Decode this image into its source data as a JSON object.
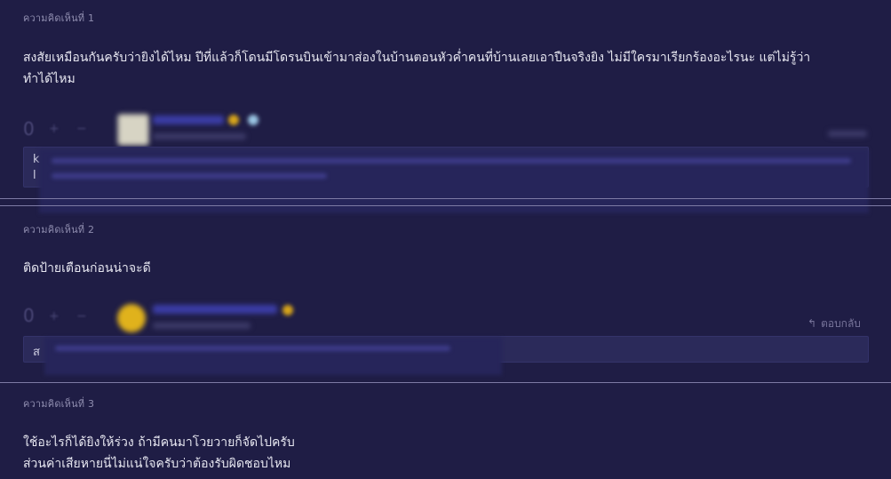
{
  "comments": [
    {
      "label": "ความคิดเห็นที่ 1",
      "lines": [
        "สงสัยเหมือนกันครับว่ายิงได้ไหม ปีที่แล้วก็โดนมีโดรนบินเข้ามาส่องในบ้านตอนหัวค่ำคนที่บ้านเลยเอาปืนจริงยิง ไม่มีใครมาเรียกร้องอะไรนะ แต่ไม่รู้ว่า",
        "ทำได้ไหม"
      ],
      "vote_count": "0",
      "reply_peek": "k",
      "reply_peek_2": "l"
    },
    {
      "label": "ความคิดเห็นที่ 2",
      "lines": [
        "ติดป้ายเตือนก่อนน่าจะดี"
      ],
      "vote_count": "0",
      "reply_label": "ตอบกลับ",
      "reply_peek": "ส"
    },
    {
      "label": "ความคิดเห็นที่ 3",
      "lines": [
        "ใช้อะไรก็ได้ยิงให้ร่วง ถ้ามีคนมาโวยวายก็จัดไปครับ",
        "ส่วนค่าเสียหายนี่ไม่แน่ใจครับว่าต้องรับผิดชอบไหม"
      ]
    }
  ],
  "icons": {
    "upvote": "plus-icon",
    "downvote": "minus-icon",
    "reply": "reply-arrow-icon"
  },
  "colors": {
    "background": "#1f1d45",
    "text": "#e6e6f0",
    "label": "#8f8daf",
    "divider": "#7d7aa4"
  }
}
